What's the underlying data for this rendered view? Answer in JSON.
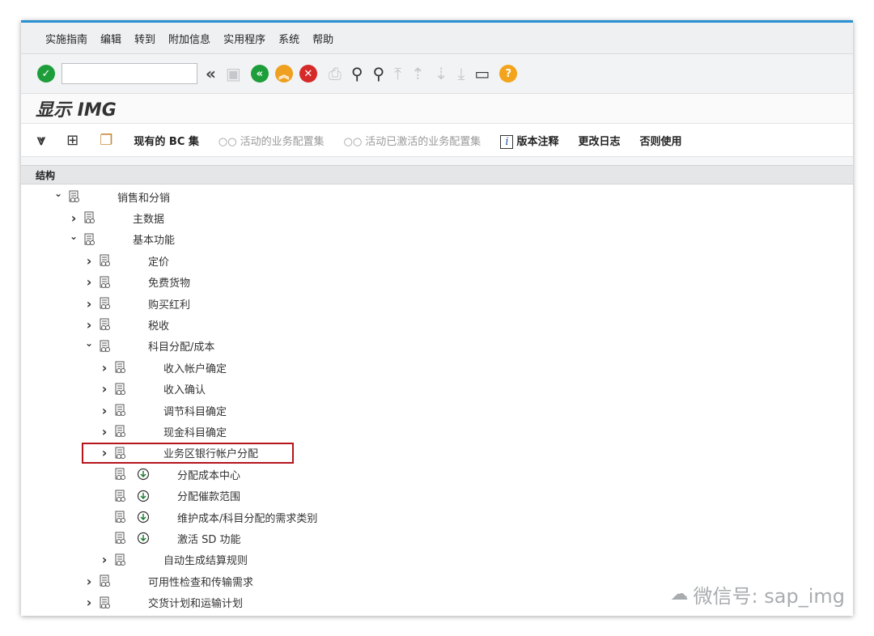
{
  "menubar": {
    "items": [
      "实施指南",
      "编辑",
      "转到",
      "附加信息",
      "实用程序",
      "系统",
      "帮助"
    ]
  },
  "toolbar": {
    "command_value": "",
    "icons": [
      "check-icon",
      "double-left-arrow-icon",
      "save-icon",
      "back-icon",
      "exit-icon",
      "cancel-icon",
      "print-icon",
      "find-icon",
      "find-next-icon",
      "first-page-icon",
      "previous-page-icon",
      "next-page-icon",
      "last-page-icon",
      "create-session-icon",
      "help-icon"
    ]
  },
  "title": "显示 IMG",
  "apptoolbar": {
    "existing_bc_sets": "现有的 BC 集",
    "active_bc_sets": "活动的业务配置集",
    "activated_bc_sets": "活动已激活的业务配置集",
    "release_notes": "版本注释",
    "change_log": "更改日志",
    "otherwise_use": "否则使用"
  },
  "tree": {
    "header": "结构",
    "nodes": [
      {
        "label": "销售和分销",
        "level": 0,
        "state": "expanded",
        "exec": false
      },
      {
        "label": "主数据",
        "level": 1,
        "state": "collapsed",
        "exec": false
      },
      {
        "label": "基本功能",
        "level": 1,
        "state": "expanded",
        "exec": false
      },
      {
        "label": "定价",
        "level": 2,
        "state": "collapsed",
        "exec": false
      },
      {
        "label": "免费货物",
        "level": 2,
        "state": "collapsed",
        "exec": false
      },
      {
        "label": "购买红利",
        "level": 2,
        "state": "collapsed",
        "exec": false
      },
      {
        "label": "税收",
        "level": 2,
        "state": "collapsed",
        "exec": false
      },
      {
        "label": "科目分配/成本",
        "level": 2,
        "state": "expanded",
        "exec": false
      },
      {
        "label": "收入帐户确定",
        "level": 3,
        "state": "collapsed",
        "exec": false
      },
      {
        "label": "收入确认",
        "level": 3,
        "state": "collapsed",
        "exec": false
      },
      {
        "label": "调节科目确定",
        "level": 3,
        "state": "collapsed",
        "exec": false
      },
      {
        "label": "现金科目确定",
        "level": 3,
        "state": "collapsed",
        "exec": false
      },
      {
        "label": "业务区银行帐户分配",
        "level": 3,
        "state": "collapsed",
        "exec": false
      },
      {
        "label": "分配成本中心",
        "level": 3,
        "state": "leaf",
        "exec": true
      },
      {
        "label": "分配催款范围",
        "level": 3,
        "state": "leaf",
        "exec": true
      },
      {
        "label": "维护成本/科目分配的需求类别",
        "level": 3,
        "state": "leaf",
        "exec": true
      },
      {
        "label": "激活 SD 功能",
        "level": 3,
        "state": "leaf",
        "exec": true
      },
      {
        "label": "自动生成结算规则",
        "level": 3,
        "state": "collapsed",
        "exec": false
      },
      {
        "label": "可用性检查和传输需求",
        "level": 2,
        "state": "collapsed",
        "exec": false
      },
      {
        "label": "交货计划和运输计划",
        "level": 2,
        "state": "collapsed",
        "exec": false
      }
    ],
    "highlighted": "分配成本中心"
  },
  "watermark": "微信号: sap_img",
  "colors": {
    "accent": "#2a8fd0",
    "highlight_border": "#b5151b",
    "check_green": "#1e9e3b",
    "back_green": "#1e9e3b",
    "exit_orange": "#f0a020",
    "cancel_red": "#d62a2a",
    "help_orange": "#f3a41c"
  }
}
